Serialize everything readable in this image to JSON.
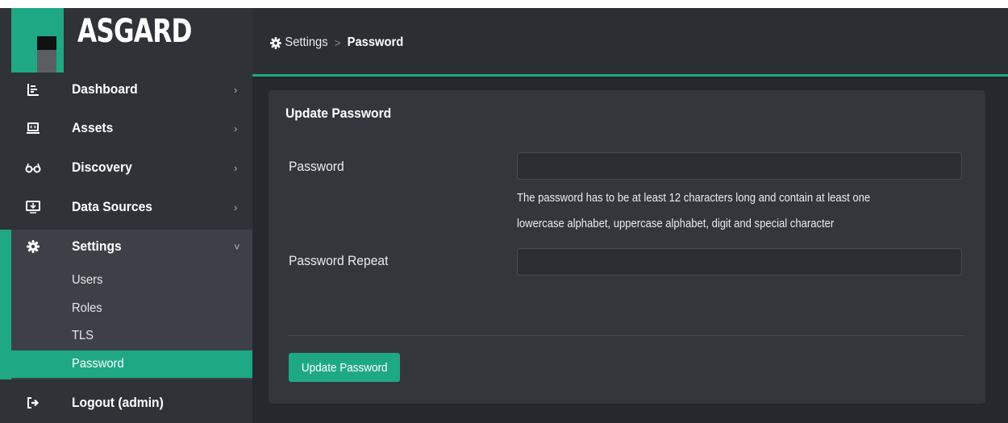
{
  "app": {
    "brand": "ASGARD",
    "accent_color": "#1fa884"
  },
  "sidebar": {
    "items": [
      {
        "label": "Dashboard",
        "icon": "chart-icon"
      },
      {
        "label": "Assets",
        "icon": "laptop-code-icon"
      },
      {
        "label": "Discovery",
        "icon": "glasses-icon"
      },
      {
        "label": "Data Sources",
        "icon": "desktop-download-icon"
      },
      {
        "label": "Settings",
        "icon": "gear-icon"
      }
    ],
    "settings_sub": [
      "Users",
      "Roles",
      "TLS",
      "Password"
    ],
    "logout": {
      "label": "Logout (admin)",
      "icon": "sign-out-icon"
    },
    "chevron_right": "›",
    "chevron_down": "˅"
  },
  "header": {
    "breadcrumb": [
      "Settings",
      "Password"
    ],
    "separator": ">"
  },
  "card": {
    "title": "Update Password",
    "password_label": "Password",
    "password_repeat_label": "Password Repeat",
    "help_line1": "The password has to be at least 12 characters long and contain at least one",
    "help_line2": "lowercase alphabet, uppercase alphabet, digit and special character",
    "submit_label": "Update Password"
  }
}
